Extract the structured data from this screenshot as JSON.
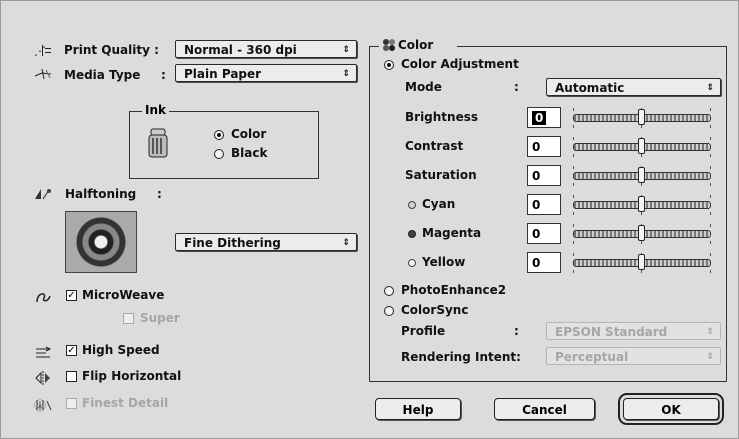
{
  "print_quality": {
    "label": "Print Quality :",
    "value": "Normal - 360 dpi",
    "icon": "print-quality-icon"
  },
  "media_type": {
    "label": "Media Type",
    "colon": ":",
    "value": "Plain Paper",
    "icon": "media-type-icon"
  },
  "ink": {
    "title": "Ink",
    "color_label": "Color",
    "black_label": "Black",
    "selected": "Color"
  },
  "halftoning": {
    "label": "Halftoning",
    "colon": ":",
    "value": "Fine Dithering"
  },
  "microweave": {
    "label": "MicroWeave",
    "checked": true,
    "super_label": "Super",
    "super_enabled": false
  },
  "high_speed": {
    "label": "High Speed",
    "checked": true
  },
  "flip_horizontal": {
    "label": "Flip Horizontal",
    "checked": false
  },
  "finest_detail": {
    "label": "Finest Detail",
    "checked": false,
    "enabled": false
  },
  "color_group": {
    "title": "Color",
    "color_adjustment_label": "Color Adjustment",
    "mode_label": "Mode",
    "mode_colon": ":",
    "mode_value": "Automatic",
    "sliders": [
      {
        "label": "Brightness",
        "value": "0",
        "selected": true
      },
      {
        "label": "Contrast",
        "value": "0"
      },
      {
        "label": "Saturation",
        "value": "0"
      },
      {
        "label": "Cyan",
        "value": "0",
        "dot": "cyan"
      },
      {
        "label": "Magenta",
        "value": "0",
        "dot": "magenta"
      },
      {
        "label": "Yellow",
        "value": "0",
        "dot": "yellow"
      }
    ],
    "photoenhance_label": "PhotoEnhance2",
    "colorsync_label": "ColorSync",
    "profile_label": "Profile",
    "profile_colon": ":",
    "profile_value": "EPSON Standard",
    "rendering_intent_label": "Rendering Intent:",
    "rendering_intent_value": "Perceptual"
  },
  "buttons": {
    "help": "Help",
    "cancel": "Cancel",
    "ok": "OK"
  },
  "colors": {
    "dialog_bg": "#dcdcdc",
    "disabled_text": "#a6a6a6"
  }
}
